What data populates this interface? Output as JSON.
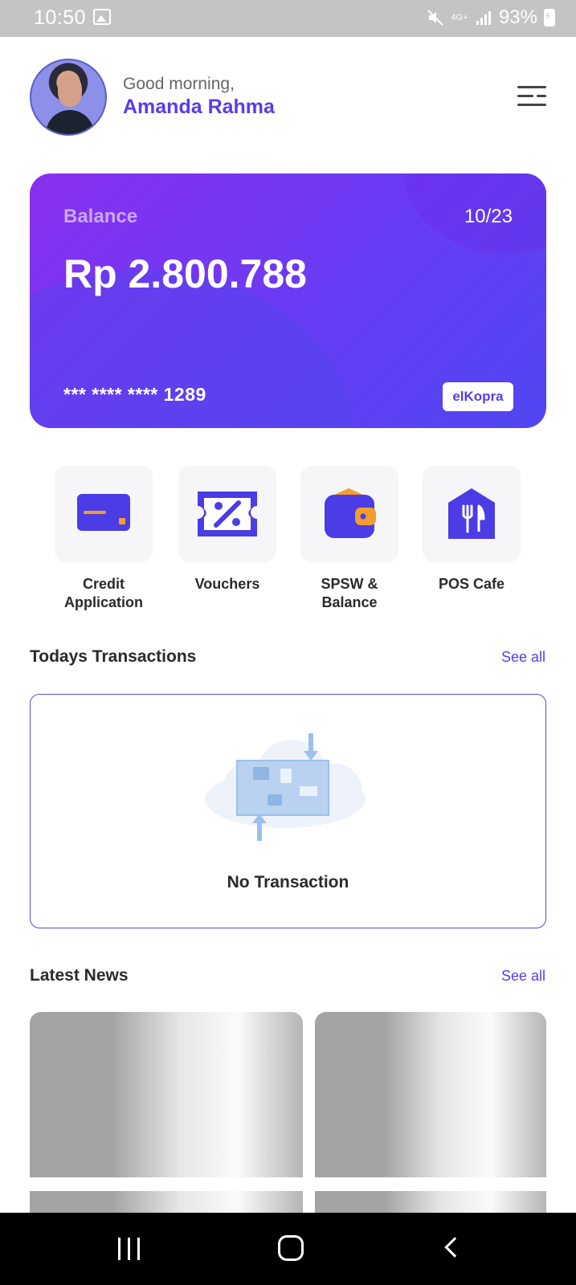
{
  "status_bar": {
    "time": "10:50",
    "network": "4G+",
    "battery": "93%",
    "icons": [
      "gallery-icon",
      "mute-icon",
      "signal-icon",
      "battery-charging-icon"
    ]
  },
  "header": {
    "greeting": "Good morning,",
    "user_name": "Amanda Rahma",
    "menu_icon": "menu-icon"
  },
  "balance_card": {
    "label": "Balance",
    "expiry": "10/23",
    "amount": "Rp 2.800.788",
    "card_number": "*** **** **** 1289",
    "brand": "elKopra",
    "colors": {
      "gradient_start": "#8a2ff0",
      "gradient_end": "#4f47f1",
      "label": "#c9a8ff"
    }
  },
  "quick_menu": [
    {
      "label": "Credit Application",
      "icon": "credit-card-icon"
    },
    {
      "label": "Vouchers",
      "icon": "voucher-icon"
    },
    {
      "label": "SPSW & Balance",
      "icon": "wallet-icon"
    },
    {
      "label": "POS Cafe",
      "icon": "restaurant-icon"
    }
  ],
  "transactions": {
    "title": "Todays Transactions",
    "see_all": "See all",
    "empty_text": "No Transaction"
  },
  "news": {
    "title": "Latest News",
    "see_all": "See all"
  },
  "colors": {
    "accent": "#5b3bea",
    "icon_orange": "#f29d2c"
  }
}
